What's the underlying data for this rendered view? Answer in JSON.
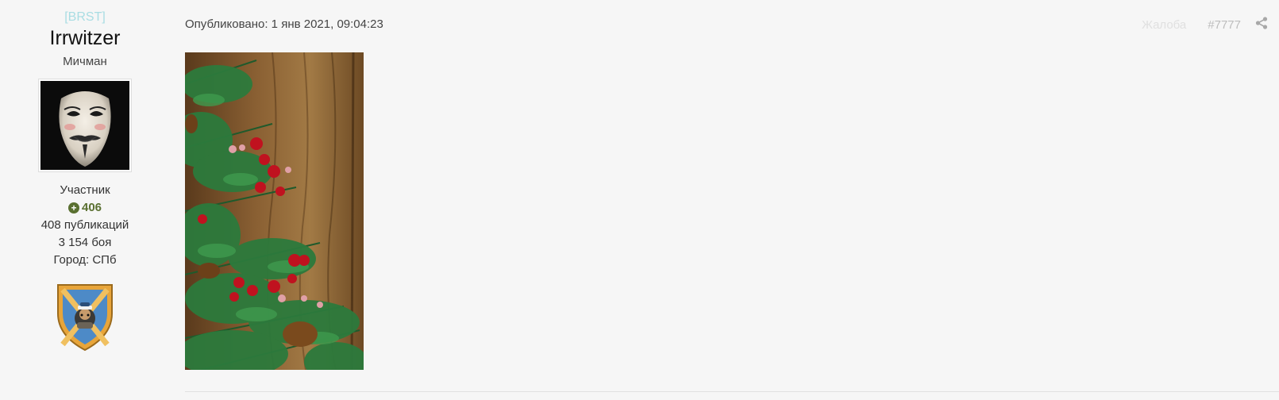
{
  "author": {
    "clan_tag": "[BRST]",
    "username": "Irrwitzer",
    "rank_title": "Мичман",
    "group": "Участник",
    "reputation": "406",
    "posts": "408 публикаций",
    "battles": "3 154 боя",
    "city": "Город: СПб"
  },
  "post": {
    "published": "Опубликовано: 1 янв 2021, 09:04:23",
    "report_label": "Жалоба",
    "post_number": "#7777"
  },
  "icons": {
    "reputation": "plus-circle-icon",
    "share": "share-icon",
    "badge": "clan-shield-badge-icon"
  },
  "colors": {
    "background": "#f6f6f6",
    "clan_tag": "#a9dde3",
    "reputation": "#5a7031",
    "report": "#e0e0e0",
    "post_number": "#bdbdbd"
  }
}
